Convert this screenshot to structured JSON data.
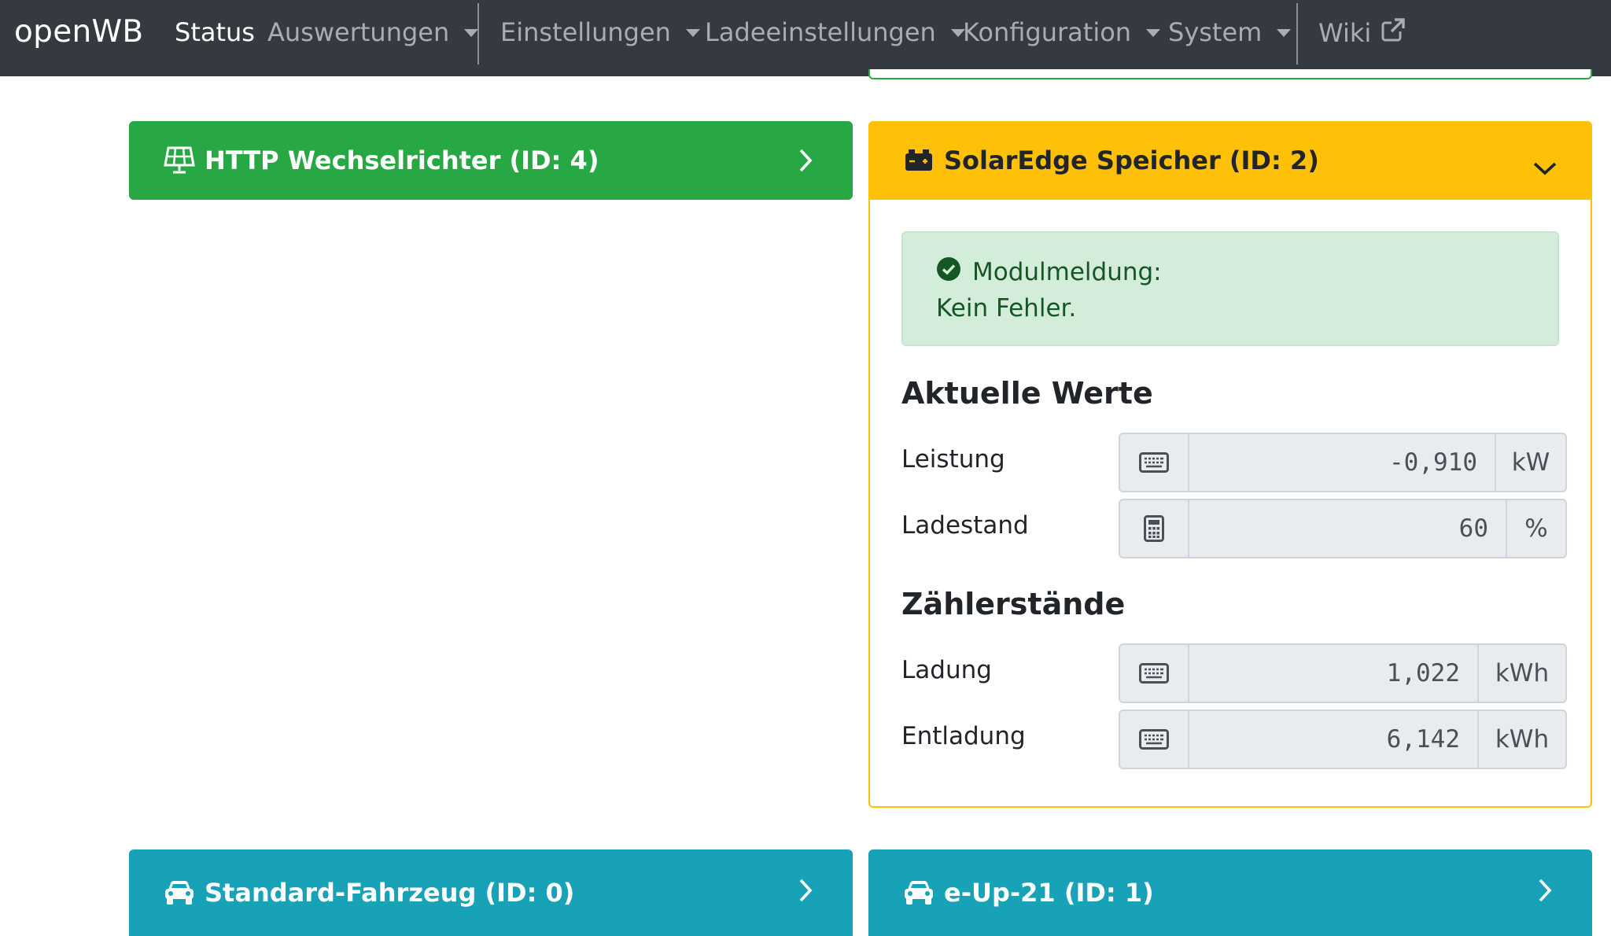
{
  "navbar": {
    "brand": "openWB",
    "items": [
      {
        "label": "Status",
        "active": true
      },
      {
        "label": "Auswertungen"
      },
      {
        "label": "Einstellungen"
      },
      {
        "label": "Ladeeinstellungen"
      },
      {
        "label": "Konfiguration"
      },
      {
        "label": "System"
      },
      {
        "label": "Wiki"
      }
    ]
  },
  "cards": {
    "inverter": {
      "title": "HTTP Wechselrichter (ID: 4)",
      "icon": "solar-panel-icon",
      "color": "#28a745"
    },
    "storage": {
      "title": "SolarEdge Speicher (ID: 2)",
      "icon": "car-battery-icon",
      "color": "#ffc107",
      "alert": {
        "heading": "Modulmeldung:",
        "text": "Kein Fehler."
      },
      "current_title": "Aktuelle Werte",
      "power": {
        "label": "Leistung",
        "value": "-0,910",
        "unit": "kW"
      },
      "soc": {
        "label": "Ladestand",
        "value": "60",
        "unit": "%"
      },
      "counters_title": "Zählerstände",
      "charge": {
        "label": "Ladung",
        "value": "1,022",
        "unit": "kWh"
      },
      "discharge": {
        "label": "Entladung",
        "value": "6,142",
        "unit": "kWh"
      }
    },
    "vehicle0": {
      "title": "Standard-Fahrzeug (ID: 0)",
      "icon": "car-icon",
      "color": "#17a2b8"
    },
    "vehicle1": {
      "title": "e-Up-21 (ID: 1)",
      "icon": "car-icon",
      "color": "#17a2b8"
    }
  }
}
